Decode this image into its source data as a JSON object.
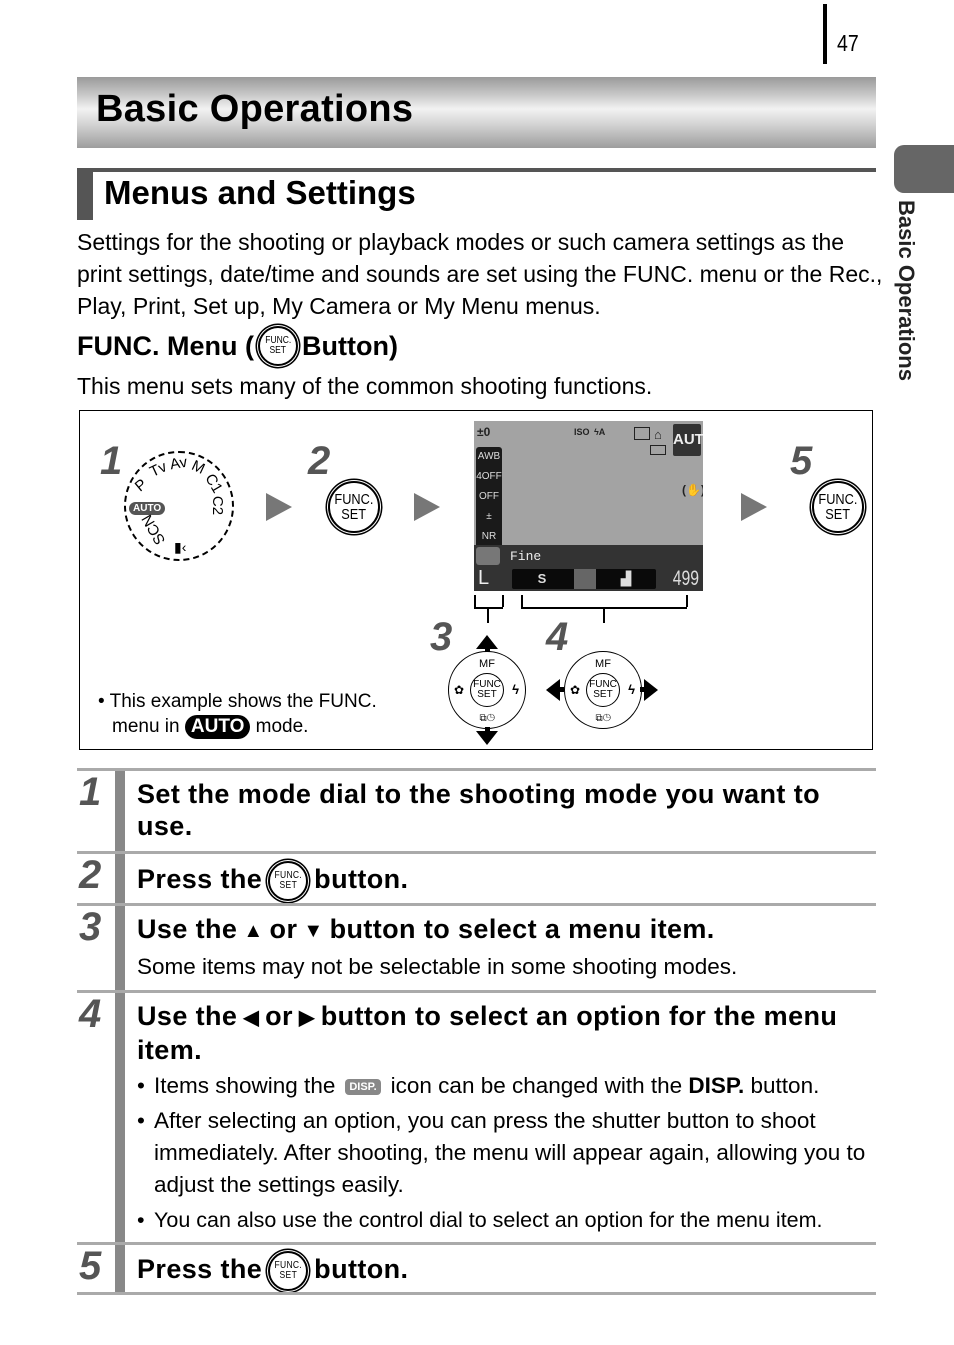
{
  "page_number": "47",
  "chapter_title": "Basic Operations",
  "side_tab_label": "Basic Operations",
  "section_title": "Menus and Settings",
  "intro_text": "Settings for the shooting or playback modes or such camera settings as the print settings, date/time and sounds are set using the FUNC. menu or the Rec., Play, Print, Set up, My Camera or My Menu menus.",
  "func_heading": {
    "prefix": "FUNC. Menu (",
    "suffix": " Button)"
  },
  "func_description": "This menu sets many of the common shooting functions.",
  "func_set_icon": {
    "line1": "FUNC.",
    "line2": "SET"
  },
  "figure": {
    "step_numbers": [
      "1",
      "2",
      "3",
      "4",
      "5"
    ],
    "mode_dial_labels": [
      "P",
      "Tv",
      "Av",
      "M",
      "C1",
      "C2",
      "AUTO",
      "SCN"
    ],
    "lcd": {
      "ev": "±0",
      "left_column": [
        "AWB",
        "4OFF",
        "OFF",
        "±",
        "NR"
      ],
      "top_icons": [
        "ISO AUTO",
        "flash auto"
      ],
      "mode": "AUTO",
      "quality_label": "Fine",
      "quality_options": [
        "S",
        "fine",
        "normal"
      ],
      "resolution": "L",
      "shots_remaining": "499"
    },
    "dpad": {
      "top": "MF",
      "center_line1": "FUNC",
      "center_line2": "SET",
      "left": "macro",
      "right": "flash",
      "bottom": "drive/self-timer"
    },
    "note_prefix": "This example shows the FUNC.",
    "note_line2_prefix": "menu in",
    "note_mode": "AUTO",
    "note_suffix": "mode."
  },
  "steps": [
    {
      "number": "1",
      "title": "Set the mode dial to the shooting mode you want to use."
    },
    {
      "number": "2",
      "title_prefix": "Press the",
      "title_suffix": "button."
    },
    {
      "number": "3",
      "title_prefix": "Use the",
      "title_mid": "or",
      "title_suffix": "button to select a menu item.",
      "note": "Some items may not be selectable in some shooting modes."
    },
    {
      "number": "4",
      "title_prefix": "Use the",
      "title_mid": "or",
      "title_suffix": "button to select an option for the menu item.",
      "bullets": [
        {
          "prefix": "Items showing the",
          "icon": "DISP.",
          "middle": "icon can be changed with the",
          "bold": "DISP.",
          "suffix": "button."
        },
        {
          "text": "After selecting an option, you can press the shutter button to shoot immediately. After shooting, the menu will appear again, allowing you to adjust the settings easily."
        },
        {
          "text": "You can also use the control dial to select an option for the menu item."
        }
      ]
    },
    {
      "number": "5",
      "title_prefix": "Press the",
      "title_suffix": "button."
    }
  ],
  "colors": {
    "step_number": "#555555",
    "step_bar": "#888888",
    "rule": "#aaaaaa",
    "section_bar": "#555555",
    "side_tab": "#666666"
  }
}
